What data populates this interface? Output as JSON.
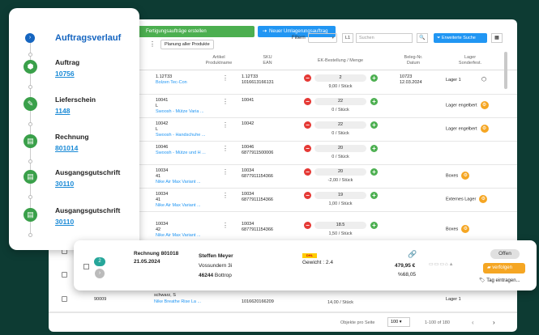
{
  "toolbar": {
    "create_production_label": "Fertigungsaufträge erstellen",
    "new_transfer_label": "Neuer Umlagerungsauftrag",
    "plan_all_label": "Planung aller Produkte",
    "filter_label": "Filtern",
    "filter_select_arrow": "▾",
    "level_label": "L1",
    "search_placeholder": "Suchen",
    "extended_search_label": "Erweiterte Suche"
  },
  "columns": {
    "article": [
      "Artikel",
      "Produktname"
    ],
    "sku": [
      "SKU",
      "EAN"
    ],
    "ek": "EK-Bestellung / Menge",
    "beleg": [
      "Beleg-Nr.",
      "Datum"
    ],
    "lager": [
      "Lager",
      "Sonderfest."
    ]
  },
  "rows": [
    {
      "article": "1.12T33",
      "name": "Bolzen Tec-Con",
      "sku": "1.12T33",
      "ean": "1016613166131",
      "qty": "2",
      "per": "9,00 / Stück",
      "beleg": "10723",
      "datum": "12.03.2024",
      "lager": "Lager 1",
      "badge": ""
    },
    {
      "article": "10041",
      "variant": "L",
      "name": "Swoosh - Mütze Varia ...",
      "sku": "10041",
      "ean": "",
      "qty": "22",
      "per": "0 / Stück",
      "beleg": "",
      "datum": "",
      "lager": "Lager engelbert",
      "badge": "⚙"
    },
    {
      "article": "10042",
      "variant": "L",
      "name": "Swoosh - Handschuhe ...",
      "sku": "10042",
      "ean": "",
      "qty": "22",
      "per": "0 / Stück",
      "beleg": "",
      "datum": "",
      "lager": "Lager engelbert",
      "badge": "⚙"
    },
    {
      "article": "10046",
      "variant": "",
      "name": "Swoosh - Mütze und H ...",
      "sku": "10046",
      "ean": "6877911500006",
      "qty": "20",
      "per": "0 / Stück",
      "beleg": "",
      "datum": "",
      "lager": "",
      "badge": ""
    },
    {
      "article": "10034",
      "variant": "41",
      "name": "Nike Air Max Variant ...",
      "sku": "10034",
      "ean": "6877911154366",
      "qty": "20",
      "per": "-2,00 / Stück",
      "beleg": "",
      "datum": "",
      "lager": "Boxes",
      "badge": "⚙"
    },
    {
      "article": "10034",
      "variant": "41",
      "name": "Nike Air Max Variant ...",
      "sku": "10034",
      "ean": "6877911154366",
      "qty": "19",
      "per": "1,00 / Stück",
      "beleg": "",
      "datum": "",
      "lager": "Externes Lager",
      "badge": "⚙"
    },
    {
      "article": "10034",
      "variant": "42",
      "name": "Nike Air Max Variant ...",
      "sku": "10034",
      "ean": "6877911154366",
      "qty": "18.5",
      "per": "1,50 / Stück",
      "beleg": "",
      "datum": "",
      "lager": "Boxes",
      "badge": "⚙"
    }
  ],
  "last_row": {
    "id": "90009",
    "name_top": "schwarz, S",
    "name": "Nike Breathe Rise La ...",
    "ean": "1016620166209",
    "per": "14,00 / Stück",
    "lager": "Lager 1"
  },
  "footer": {
    "per_page_label": "Objekte pro Seite",
    "per_page_value": "100",
    "range": "1-100 of 180"
  },
  "timeline": {
    "heading": "Auftragsverlauf",
    "items": [
      {
        "title": "Auftrag",
        "link": "10756"
      },
      {
        "title": "Lieferschein",
        "link": "1148"
      },
      {
        "title": "Rechnung",
        "link": "801014"
      },
      {
        "title": "Ausgangsgutschrift",
        "link": "30110"
      },
      {
        "title": "Ausgangsgutschrift",
        "link": "30110"
      }
    ]
  },
  "order_card": {
    "count": "2",
    "title": "Rechnung 801018",
    "date": "21.05.2024",
    "customer": "Steffen Meyer",
    "street": "Vossundern 3i",
    "zip": "46244",
    "city": "Bottrop",
    "carrier": "DHL",
    "weight": "Gewicht : 2.4",
    "amount": "479,95 €",
    "percent": "%68,05",
    "status": "Offen",
    "track_label": "verfolgen",
    "tag_label": "Tag eintragen..."
  }
}
